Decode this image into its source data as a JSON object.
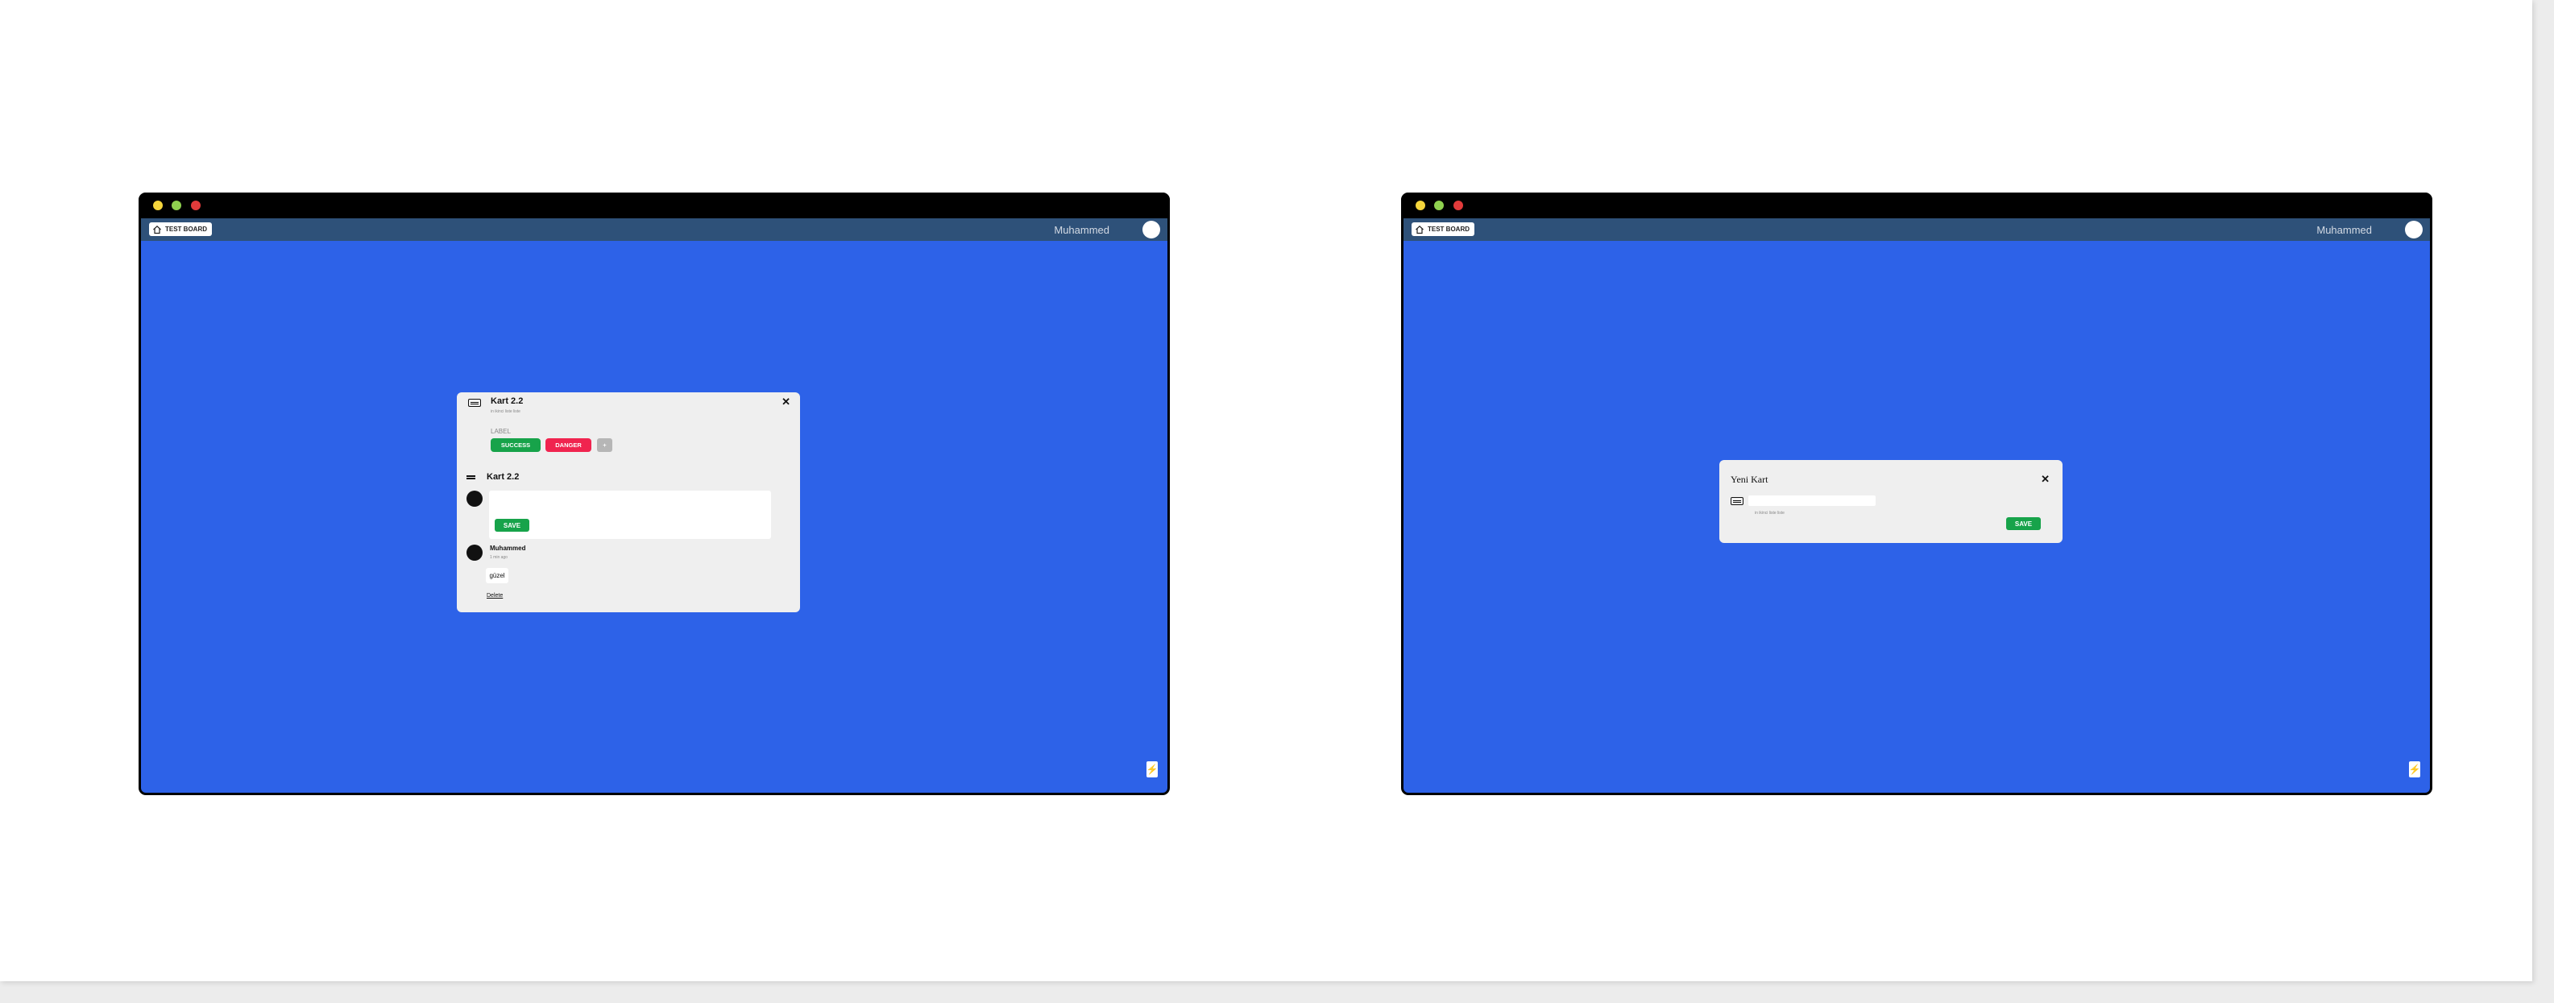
{
  "windows": [
    {
      "nav": {
        "board_label": "TEST BOARD",
        "username": "Muhammed"
      },
      "card_modal": {
        "title": "Kart 2.2",
        "subtitle": "in ikinci liste liste",
        "label_caption": "LABEL",
        "labels": [
          {
            "text": "SUCCESS",
            "color": "#17a34a"
          },
          {
            "text": "DANGER",
            "color": "#f0244f"
          }
        ],
        "add_label": "+",
        "description_title": "Kart 2.2",
        "save_label": "SAVE",
        "comment": {
          "author": "Muhammed",
          "time": "1 min ago",
          "text": "güzel",
          "delete_label": "Delete"
        }
      }
    },
    {
      "nav": {
        "board_label": "TEST BOARD",
        "username": "Muhammed"
      },
      "new_card_modal": {
        "title": "Yeni Kart",
        "input_value": "",
        "subtitle": "in ikinci liste liste",
        "save_label": "SAVE"
      }
    }
  ],
  "icons": {
    "home": "home-icon",
    "card": "card-icon",
    "close": "close-icon",
    "description": "description-icon",
    "bolt": "bolt-icon"
  },
  "colors": {
    "board_background": "#2d62e8",
    "nav_background": "#2e5179",
    "success": "#17a34a",
    "danger": "#f0244f"
  }
}
